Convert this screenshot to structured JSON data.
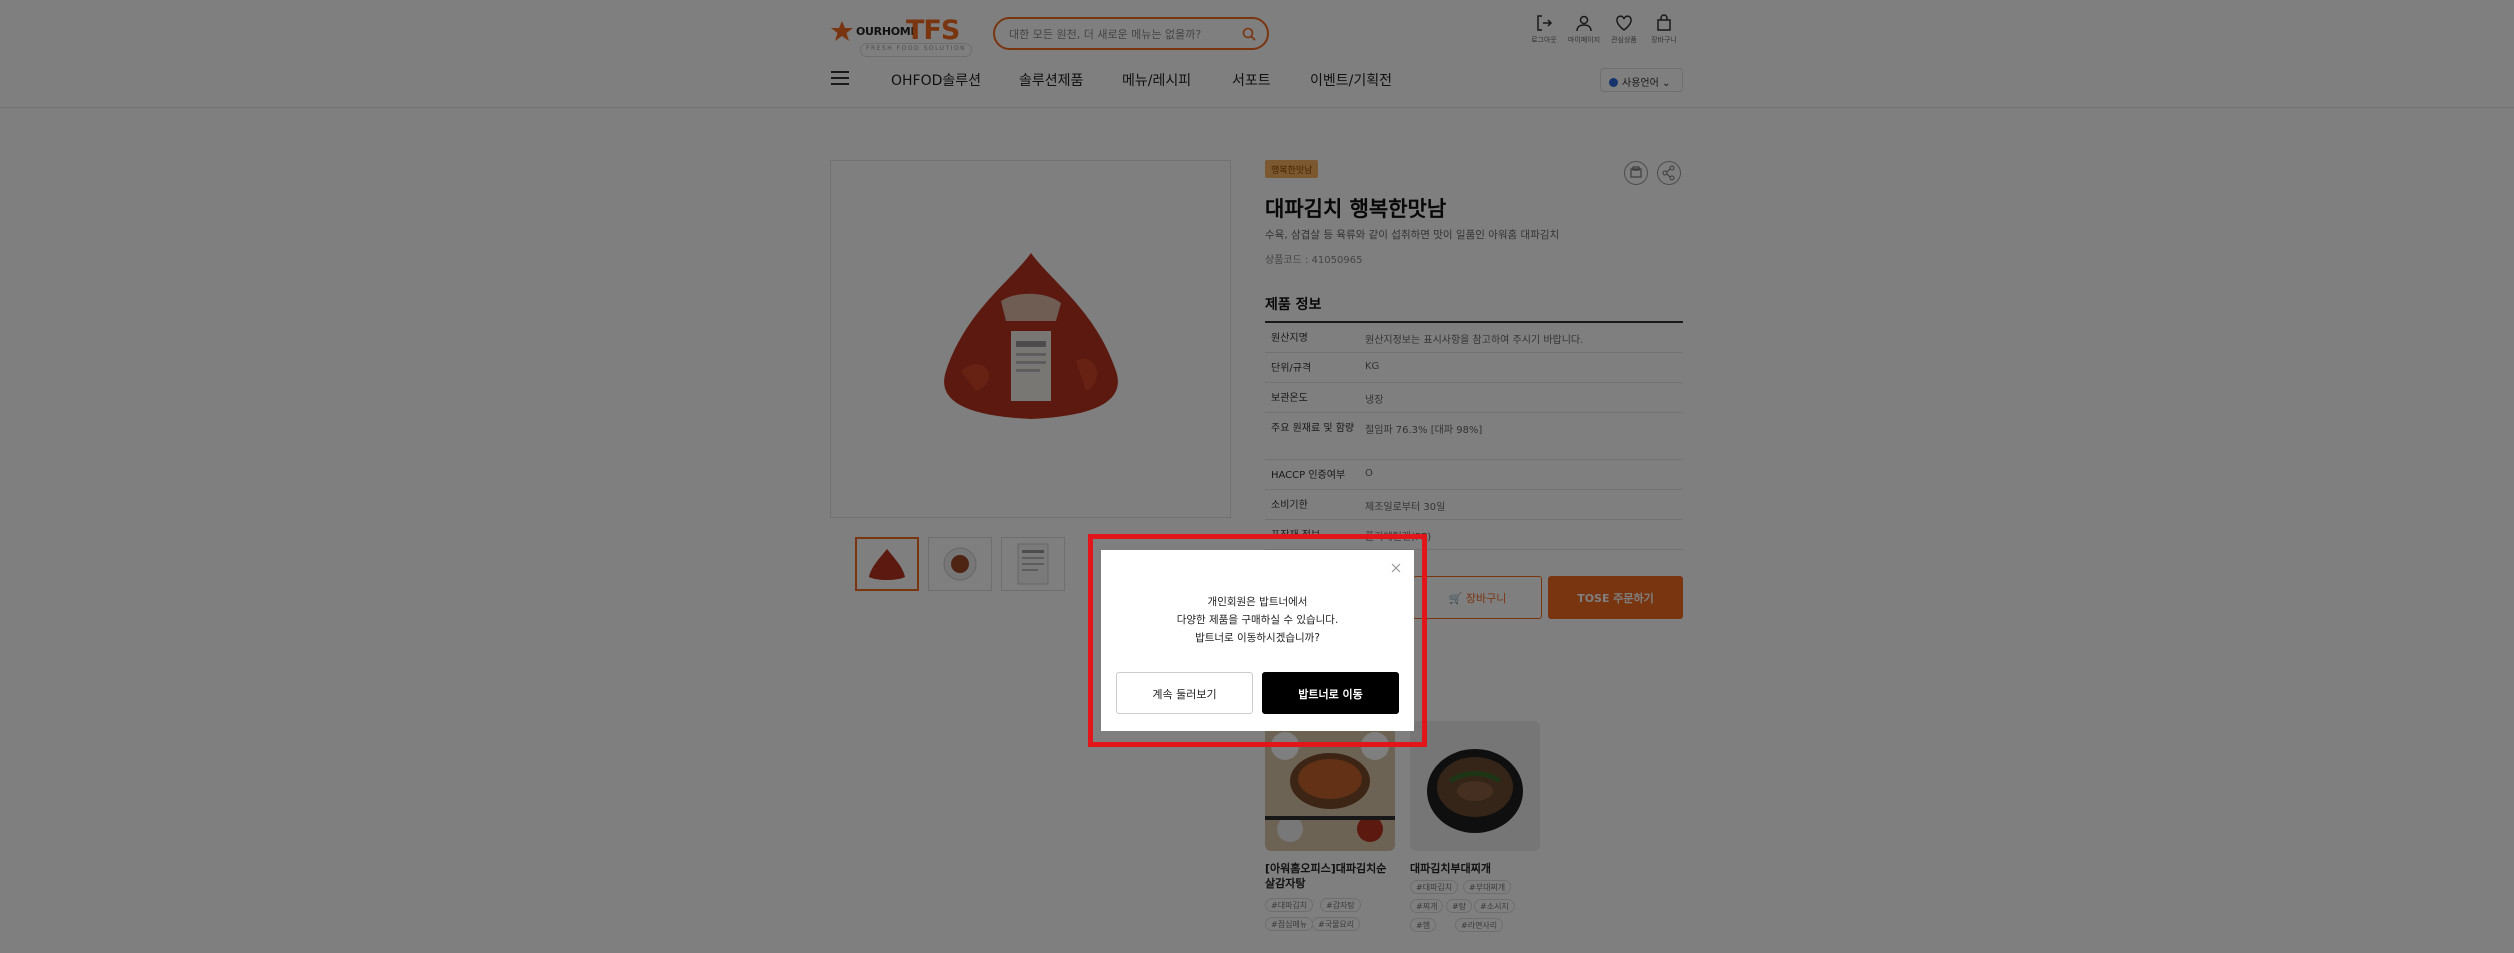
{
  "header": {
    "logo": {
      "small": "OURHOME",
      "big": "TFS",
      "tagline": "FRESH FOOD SOLUTION"
    },
    "search": {
      "placeholder": "대한 모든 원천, 더 새로운 메뉴는 없을까?"
    },
    "utilities": [
      {
        "label": "로그아웃",
        "icon": "logout-icon"
      },
      {
        "label": "마이페이지",
        "icon": "user-icon"
      },
      {
        "label": "관심상품",
        "icon": "heart-icon"
      },
      {
        "label": "장바구니",
        "icon": "bag-icon"
      }
    ],
    "nav": [
      "OHFOD솔루션",
      "솔루션제품",
      "메뉴/레시피",
      "서포트",
      "이벤트/기획전"
    ],
    "language": "사용언어"
  },
  "product": {
    "badge": "행복한맛남",
    "title": "대파김치 행복한맛남",
    "description": "수육, 삼겹살 등 육류와 같이 섭취하면 맛이 일품인 아워홈 대파김치",
    "code": "상품코드 : 41050965",
    "info_title": "제품 정보",
    "info": [
      {
        "key": "원산지명",
        "value": "원산지정보는 표시사항을 참고하여 주시기 바랍니다."
      },
      {
        "key": "단위/규격",
        "value": "KG"
      },
      {
        "key": "보관온도",
        "value": "냉장"
      },
      {
        "key": "주요 원재료 및 함량",
        "value": "절임파 76.3% [대파 98%]"
      },
      {
        "key": "HACCP 인증여부",
        "value": "O"
      },
      {
        "key": "소비기한",
        "value": "제조일로부터 30일"
      },
      {
        "key": "포장재 정보",
        "value": "폴리에틸렌(PE)"
      }
    ],
    "cart_label": "장바구니",
    "order_label": "TOSE 주문하기"
  },
  "related": [
    {
      "title_line1": "[아워홈오피스]대파김치순",
      "title_line2": "살감자탕",
      "tags": [
        "#대파김치",
        "#감자탕",
        "#점심메뉴",
        "#국물요리"
      ]
    },
    {
      "title_line1": "대파김치부대찌개",
      "title_line2": "",
      "tags": [
        "#대파김치",
        "#부대찌개",
        "#찌개",
        "#탕",
        "#소시지",
        "#햄",
        "#라면사리"
      ]
    }
  ],
  "modal": {
    "message_lines": [
      "개인회원은 밥트너에서",
      "다양한 제품을 구매하실 수 있습니다.",
      "밥트너로 이동하시겠습니까?"
    ],
    "continue_label": "계속 둘러보기",
    "go_label": "밥트너로 이동"
  },
  "colors": {
    "accent": "#f26a21",
    "highlight": "#e2151b",
    "dim": "rgba(0,0,0,0.5)"
  }
}
